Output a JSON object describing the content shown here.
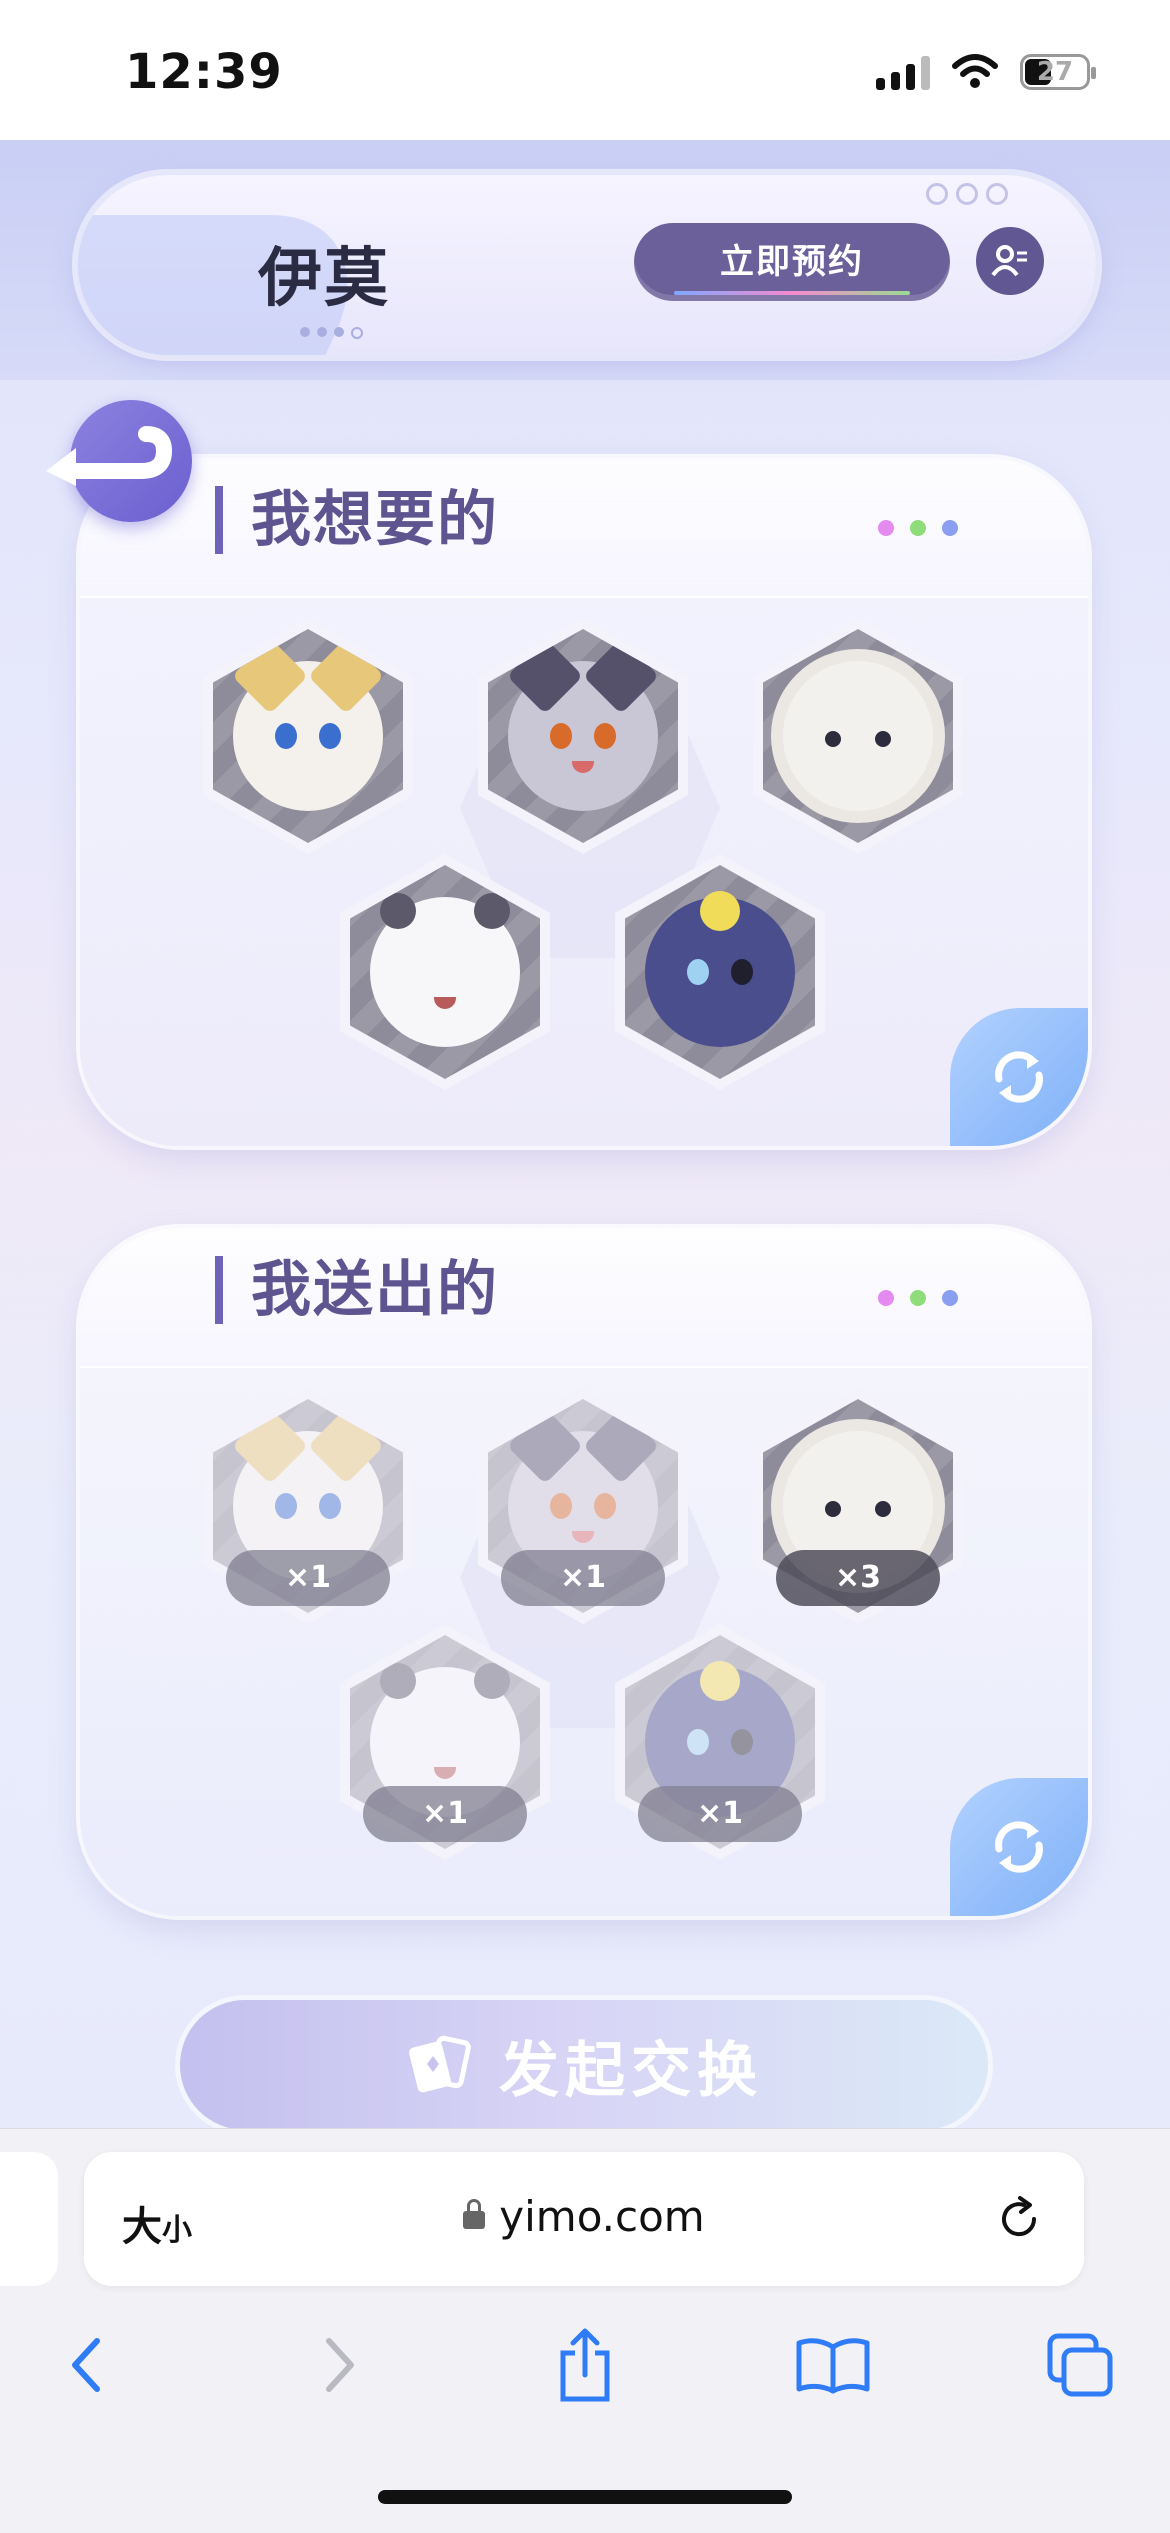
{
  "status_bar": {
    "time": "12:39",
    "battery": "27"
  },
  "header": {
    "logo": "伊莫",
    "reserve_label": "立即预约"
  },
  "want_section": {
    "title": "我想要的",
    "pets": [
      {
        "name": "cream-fox"
      },
      {
        "name": "gray-wolf"
      },
      {
        "name": "fluffy-sheep"
      },
      {
        "name": "white-bear"
      },
      {
        "name": "star-mouse"
      }
    ]
  },
  "give_section": {
    "title": "我送出的",
    "pets": [
      {
        "name": "cream-fox",
        "count": "×1"
      },
      {
        "name": "gray-wolf",
        "count": "×1"
      },
      {
        "name": "fluffy-sheep",
        "count": "×3"
      },
      {
        "name": "white-bear",
        "count": "×1"
      },
      {
        "name": "star-mouse",
        "count": "×1"
      }
    ]
  },
  "exchange_label": "发起交换",
  "browser": {
    "text_size_label": "大",
    "text_size_small": "小",
    "url": "yimo.com"
  },
  "colors": {
    "accent": "#6b609a",
    "title": "#5e5590",
    "refresh": "#7eb0f8"
  },
  "dots_colors": [
    "#e58af0",
    "#8fdc7a",
    "#8a9ff0"
  ]
}
